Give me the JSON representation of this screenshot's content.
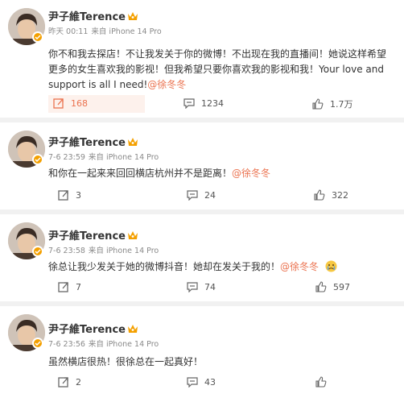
{
  "posts": [
    {
      "author": "尹子維Terence",
      "time": "昨天 00:11",
      "source": "来自 iPhone 14 Pro",
      "text": "你不和我去探店！不让我发关于你的微博！不出现在我的直播间！她说这样希望更多的女生喜欢我的影视！但我希望只要你喜欢我的影视和我！Your love and support is all I need!",
      "mention": "@徐冬冬",
      "repost_count": "168",
      "comment_count": "1234",
      "like_count": "1.7万"
    },
    {
      "author": "尹子維Terence",
      "time": "7-6 23:59",
      "source": "来自 iPhone 14 Pro",
      "text": "和你在一起来来回回横店杭州并不是距离！",
      "mention": "@徐冬冬",
      "repost_count": "3",
      "comment_count": "24",
      "like_count": "322"
    },
    {
      "author": "尹子維Terence",
      "time": "7-6 23:58",
      "source": "来自 iPhone 14 Pro",
      "text": "徐总让我少发关于她的微博抖音！她却在发关于我的！",
      "mention": "@徐冬冬",
      "emoji": "crying-face",
      "repost_count": "7",
      "comment_count": "74",
      "like_count": "597"
    },
    {
      "author": "尹子維Terence",
      "time": "7-6 23:56",
      "source": "来自 iPhone 14 Pro",
      "text": "虽然横店很热！很徐总在一起真好！",
      "repost_count": "2",
      "comment_count": "43",
      "like_count": ""
    }
  ],
  "colors": {
    "accent": "#eb7350",
    "vip": "#f4a000",
    "text": "#333333",
    "meta": "#8a8a8a"
  },
  "icons": [
    "avatar",
    "vip-crown-icon",
    "verified-badge-icon",
    "repost-icon",
    "comment-icon",
    "like-icon",
    "crying-emoji-icon"
  ]
}
